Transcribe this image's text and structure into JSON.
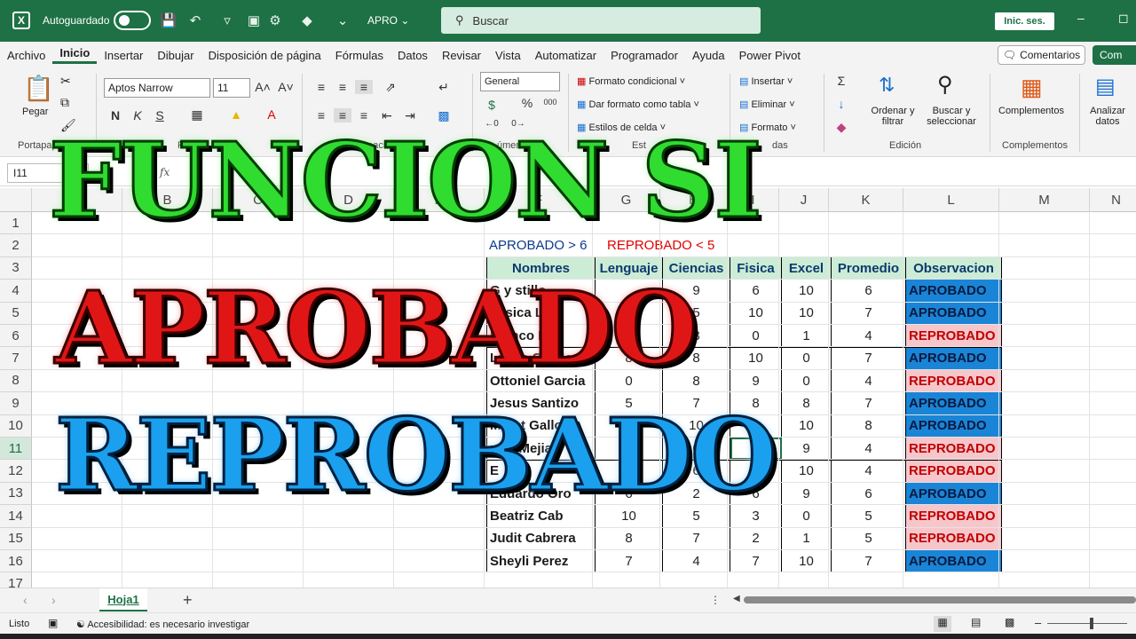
{
  "titlebar": {
    "app_icon": "X",
    "autosave_label": "Autoguardado",
    "filename": "APRO ⌄",
    "search_placeholder": "Buscar",
    "signin_label": "Inic. ses.",
    "accent": "#1e7145"
  },
  "menu": {
    "items": [
      "Archivo",
      "Inicio",
      "Insertar",
      "Dibujar",
      "Disposición de página",
      "Fórmulas",
      "Datos",
      "Revisar",
      "Vista",
      "Automatizar",
      "Programador",
      "Ayuda",
      "Power Pivot"
    ],
    "active": "Inicio",
    "comments_label": "Comentarios",
    "share_label": "Com"
  },
  "ribbon": {
    "paste_label": "Pegar",
    "font_name": "Aptos Narrow",
    "font_size": "11",
    "bold": "N",
    "italic": "K",
    "underline": "S",
    "number_format": "General",
    "conditional_format": "Formato condicional",
    "format_as_table": "Dar formato como tabla",
    "cell_styles": "Estilos de celda",
    "insert": "Insertar",
    "delete": "Eliminar",
    "format": "Formato",
    "sort_filter": "Ordenar y filtrar",
    "find_select": "Buscar y seleccionar",
    "addins": "Complementos",
    "analyze": "Analizar datos",
    "groups": {
      "clipboard": "Portapape",
      "font": "Fue",
      "alignment": "neación",
      "number": "úmero",
      "styles": "Est",
      "cells": "das",
      "editing": "Edición",
      "addins": "Complementos"
    }
  },
  "formula_bar": {
    "name_box": "I11",
    "fx": "fx"
  },
  "sheet": {
    "columns": [
      "A",
      "B",
      "C",
      "D",
      "E",
      "F",
      "G",
      "H",
      "I",
      "J",
      "K",
      "L",
      "M",
      "N"
    ],
    "rows": [
      "1",
      "2",
      "3",
      "4",
      "5",
      "6",
      "7",
      "8",
      "9",
      "10",
      "11",
      "12",
      "13",
      "14",
      "15",
      "16",
      "17"
    ],
    "selected_row": "11",
    "legend_aprobado": "APROBADO > 6",
    "legend_reprobado": "REPROBADO < 5",
    "headers": [
      "Nombres",
      "Lenguaje",
      "Ciencias",
      "Fisica",
      "Excel",
      "Promedio",
      "Observacion"
    ],
    "records": [
      {
        "name": "G   y   stillo",
        "lenguaje": "",
        "ciencias": "9",
        "fisica": "6",
        "excel": "10",
        "promedio": "6",
        "obs": "APROBADO"
      },
      {
        "name": "Yesica Lo",
        "lenguaje": "4",
        "ciencias": "5",
        "fisica": "10",
        "excel": "10",
        "promedio": "7",
        "obs": "APROBADO"
      },
      {
        "name": "Franco Esc",
        "lenguaje": "7",
        "ciencias": "8",
        "fisica": "0",
        "excel": "1",
        "promedio": "4",
        "obs": "REPROBADO"
      },
      {
        "name": "Lucas Catillo",
        "lenguaje": "8",
        "ciencias": "8",
        "fisica": "10",
        "excel": "0",
        "promedio": "7",
        "obs": "APROBADO"
      },
      {
        "name": "Ottoniel Garcia",
        "lenguaje": "0",
        "ciencias": "8",
        "fisica": "9",
        "excel": "0",
        "promedio": "4",
        "obs": "REPROBADO"
      },
      {
        "name": "Jesus Santizo",
        "lenguaje": "5",
        "ciencias": "7",
        "fisica": "8",
        "excel": "8",
        "promedio": "7",
        "obs": "APROBADO"
      },
      {
        "name": "Maret  Gallo",
        "lenguaje": "7",
        "ciencias": "10",
        "fisica": "4",
        "excel": "10",
        "promedio": "8",
        "obs": "APROBADO"
      },
      {
        "name": "  nter   Mejia",
        "lenguaje": "0",
        "ciencias": "0",
        "fisica": "8",
        "excel": "9",
        "promedio": "4",
        "obs": "REPROBADO"
      },
      {
        "name": "E",
        "lenguaje": "",
        "ciencias": "6",
        "fisica": "0",
        "excel": "10",
        "promedio": "4",
        "obs": "REPROBADO"
      },
      {
        "name": "Eduardo Oro",
        "lenguaje": "6",
        "ciencias": "2",
        "fisica": "6",
        "excel": "9",
        "promedio": "6",
        "obs": "APROBADO"
      },
      {
        "name": "Beatriz Cab",
        "lenguaje": "10",
        "ciencias": "5",
        "fisica": "3",
        "excel": "0",
        "promedio": "5",
        "obs": "REPROBADO"
      },
      {
        "name": "Judit Cabrera",
        "lenguaje": "8",
        "ciencias": "7",
        "fisica": "2",
        "excel": "1",
        "promedio": "5",
        "obs": "REPROBADO"
      },
      {
        "name": "Sheyli Perez",
        "lenguaje": "7",
        "ciencias": "4",
        "fisica": "7",
        "excel": "10",
        "promedio": "7",
        "obs": "APROBADO"
      }
    ]
  },
  "overlay": {
    "line1": "FUNCION SI",
    "line2": "APROBADO",
    "line3": "REPROBADO"
  },
  "sheet_tabs": {
    "active": "Hoja1",
    "add": "+"
  },
  "status": {
    "ready": "Listo",
    "accessibility": "Accesibilidad: es necesario investigar"
  }
}
